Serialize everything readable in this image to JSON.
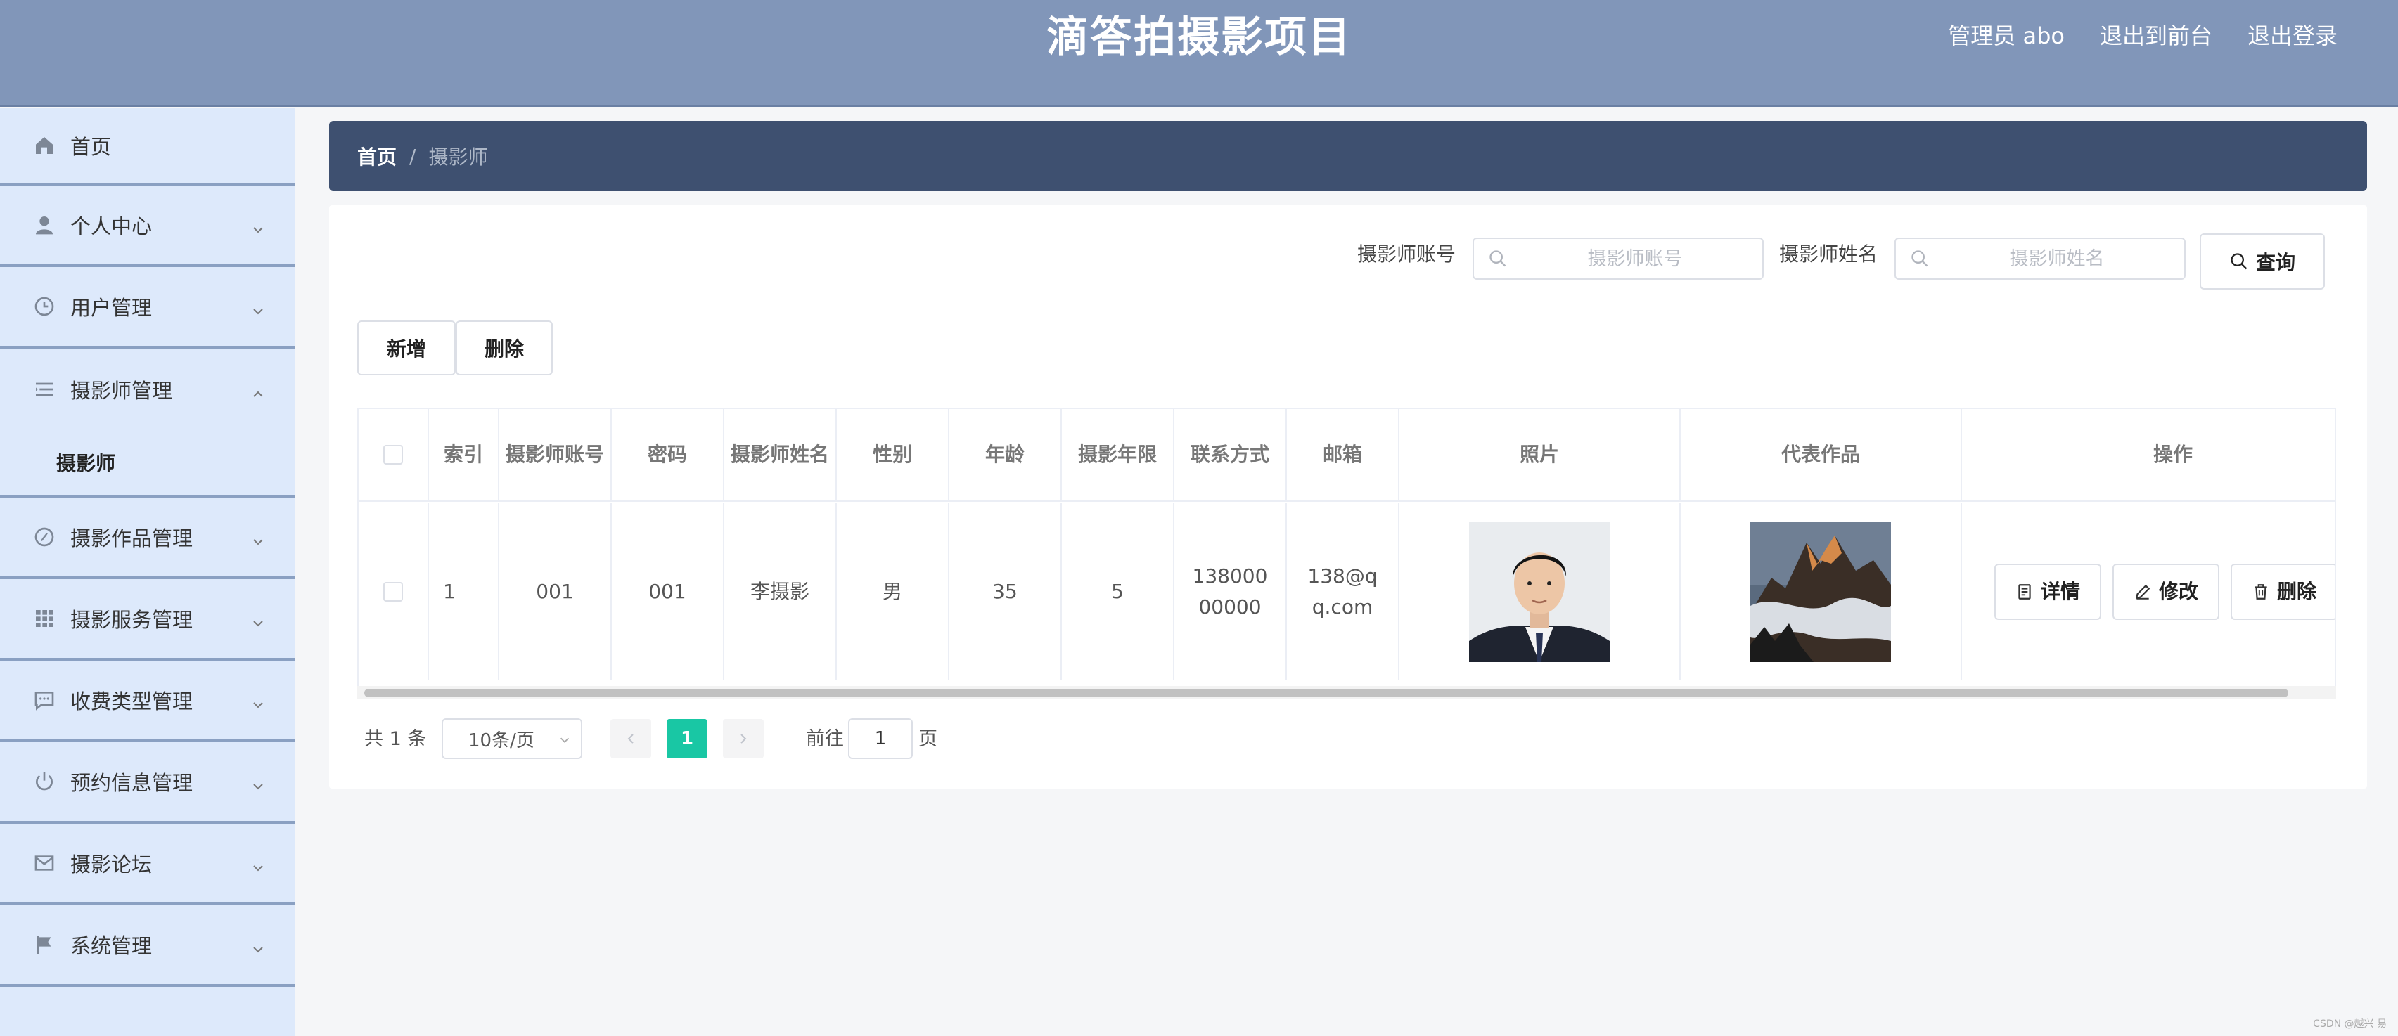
{
  "header": {
    "title": "滴答拍摄影项目",
    "admin_label": "管理员 abo",
    "front_link": "退出到前台",
    "logout_link": "退出登录"
  },
  "sidebar": {
    "items": [
      {
        "label": "首页",
        "icon": "home-icon"
      },
      {
        "label": "个人中心",
        "icon": "user-icon"
      },
      {
        "label": "用户管理",
        "icon": "clock-icon"
      },
      {
        "label": "摄影师管理",
        "icon": "list-icon",
        "expanded": true,
        "sub": [
          "摄影师"
        ]
      },
      {
        "label": "摄影作品管理",
        "icon": "compass-icon"
      },
      {
        "label": "摄影服务管理",
        "icon": "grid-icon"
      },
      {
        "label": "收费类型管理",
        "icon": "chat-icon"
      },
      {
        "label": "预约信息管理",
        "icon": "power-icon"
      },
      {
        "label": "摄影论坛",
        "icon": "mail-icon"
      },
      {
        "label": "系统管理",
        "icon": "flag-icon"
      }
    ]
  },
  "breadcrumb": {
    "home": "首页",
    "separator": "/",
    "current": "摄影师"
  },
  "search": {
    "account_label": "摄影师账号",
    "account_placeholder": "摄影师账号",
    "name_label": "摄影师姓名",
    "name_placeholder": "摄影师姓名",
    "query_button": "查询"
  },
  "toolbar": {
    "add_label": "新增",
    "delete_label": "删除"
  },
  "table": {
    "headers": [
      "索引",
      "摄影师账号",
      "密码",
      "摄影师姓名",
      "性别",
      "年龄",
      "摄影年限",
      "联系方式",
      "邮箱",
      "照片",
      "代表作品",
      "操作"
    ],
    "rows": [
      {
        "index": "1",
        "account": "001",
        "password": "001",
        "name": "李摄影",
        "gender": "男",
        "age": "35",
        "years": "5",
        "phone": "13800000000",
        "email": "138@qq.com"
      }
    ],
    "actions": {
      "detail": "详情",
      "edit": "修改",
      "delete": "删除"
    }
  },
  "pagination": {
    "total": "共 1 条",
    "page_size": "10条/页",
    "current_page": "1",
    "goto_label": "前往",
    "goto_value": "1",
    "page_suffix": "页"
  },
  "colors": {
    "header_bg": "#8196b9",
    "sidebar_bg": "#dde9fb",
    "breadcrumb_bg": "#3e5070",
    "accent": "#19c7a4"
  },
  "watermark": "CSDN @越兴 易"
}
